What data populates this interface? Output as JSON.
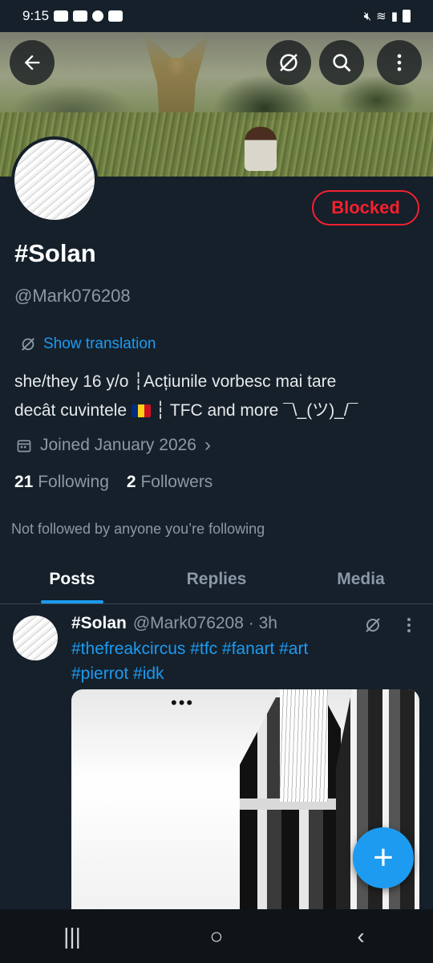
{
  "status_bar": {
    "time": "9:15",
    "left_icons": [
      "youtube-icon",
      "youtube-icon",
      "heart-icon",
      "news-icon"
    ],
    "right_icons": [
      "mute-icon",
      "wifi-icon",
      "signal-icon",
      "battery-icon"
    ]
  },
  "header": {
    "back_icon": "arrow-left-icon",
    "translate_icon": "translate-icon",
    "search_icon": "search-icon",
    "more_icon": "more-vertical-icon"
  },
  "profile": {
    "display_name": "#Solan",
    "handle": "@Mark076208",
    "blocked_label": "Blocked",
    "show_translation": "Show translation",
    "bio_line1": "she/they 16 y/o ┆Acțiunile vorbesc mai tare",
    "bio_line2_a": "decât cuvintele",
    "bio_line2_b": "┆ TFC and more ¯\\_(ツ)_/¯",
    "joined": "Joined January 2026",
    "following_count": "21",
    "following_label": "Following",
    "followers_count": "2",
    "followers_label": "Followers",
    "not_followed": "Not followed by anyone you’re following"
  },
  "tabs": [
    {
      "label": "Posts",
      "active": true
    },
    {
      "label": "Replies",
      "active": false
    },
    {
      "label": "Media",
      "active": false
    }
  ],
  "post": {
    "name": "#Solan",
    "meta": "@Mark076208 · 3h",
    "text_line1": "#thefreakcircus #tfc #fanart #art",
    "text_line2": "#pierrot #idk",
    "image_dots": "•••"
  },
  "fab_label": "+",
  "nav": {
    "recents": "|||",
    "home": "○",
    "back": "‹"
  },
  "colors": {
    "background": "#15202b",
    "accent": "#1d9bf0",
    "blocked_red": "#f4212e",
    "muted": "#8b98a5"
  }
}
